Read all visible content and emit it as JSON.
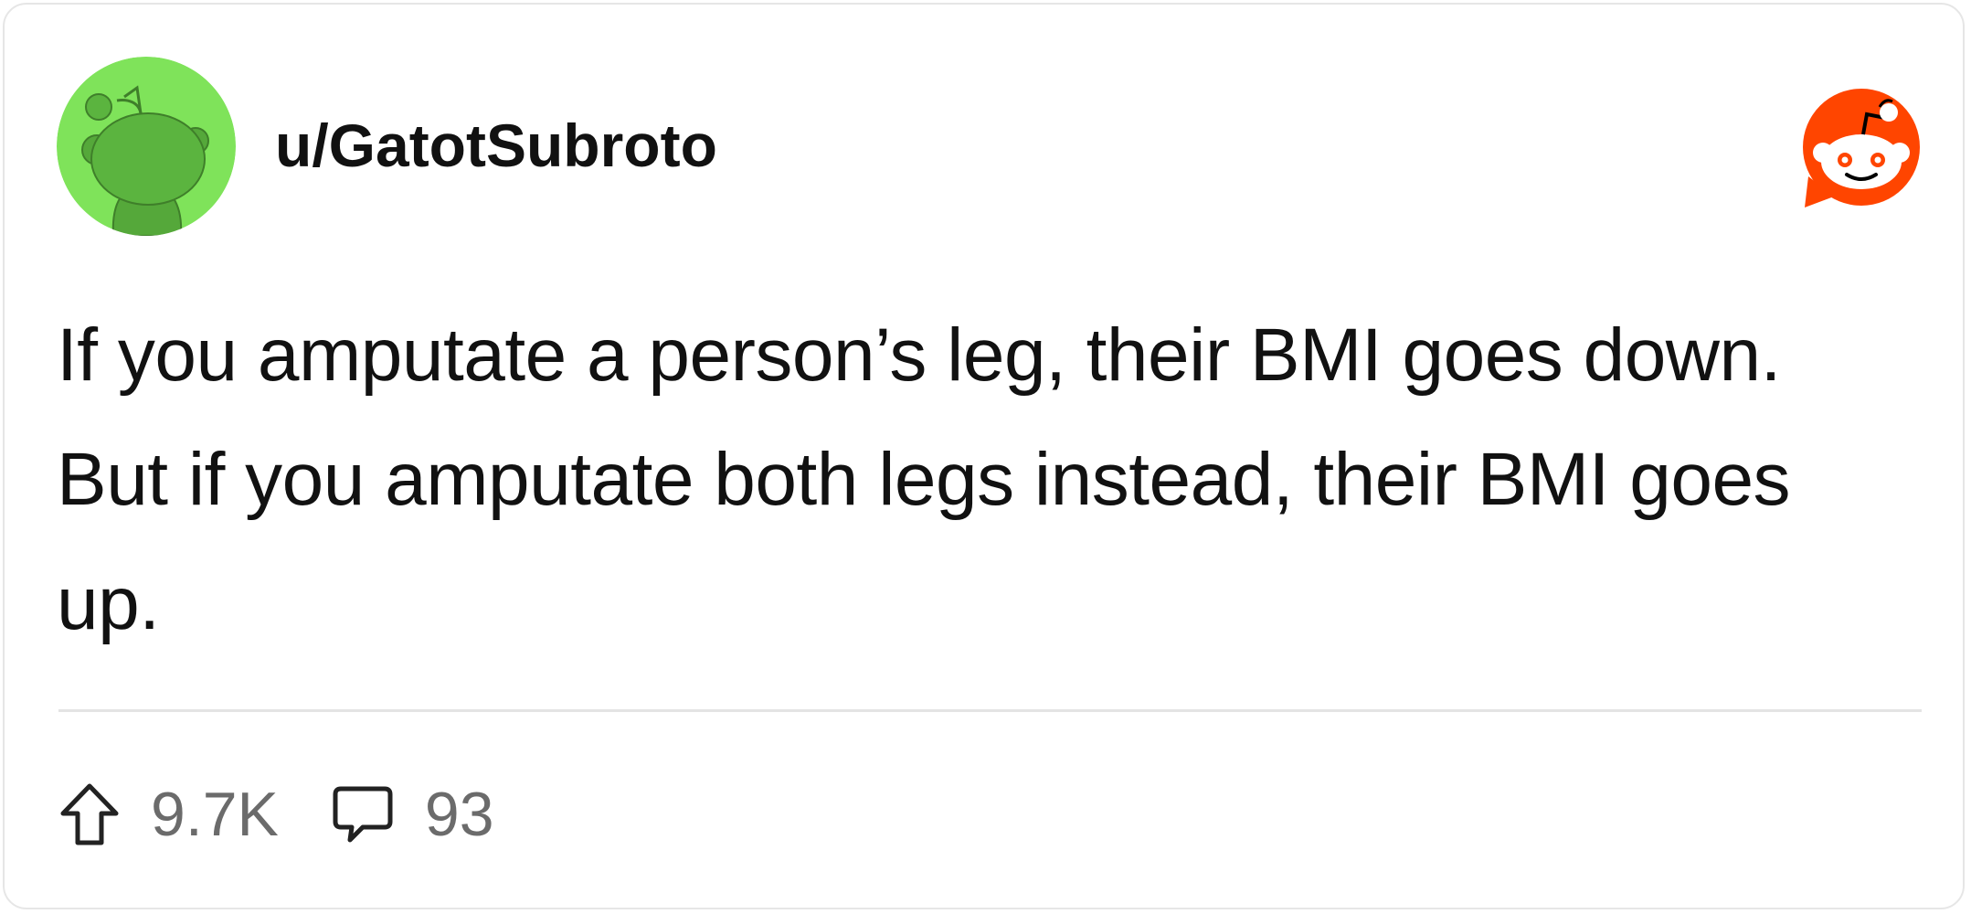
{
  "post": {
    "author": "u/GatotSubroto",
    "body": "If you amputate a person’s leg, their BMI goes down. But if you amputate both legs instead, their BMI goes up.",
    "upvotes": "9.7K",
    "comments": "93"
  },
  "icons": {
    "avatar": "snoo-avatar",
    "brand": "reddit-logo-icon",
    "upvote": "upvote-arrow-icon",
    "comment": "comment-bubble-icon"
  },
  "colors": {
    "avatar_background": "#7fe35a",
    "avatar_snoo": "#55a83a",
    "brand_orange": "#ff4500",
    "text": "#111111",
    "muted_text": "#6b6b6b",
    "divider": "#e4e4e4"
  }
}
